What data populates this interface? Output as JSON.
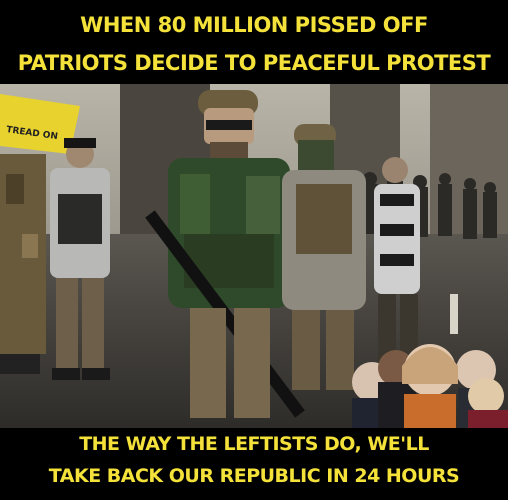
{
  "meme": {
    "top_caption": [
      "WHEN 80 MILLION PISSED OFF",
      "PATRIOTS DECIDE TO PEACEFUL PROTEST"
    ],
    "bottom_caption": [
      "THE WAY THE LEFTISTS DO, WE'LL",
      "TAKE BACK OUR REPUBLIC IN 24 HOURS"
    ],
    "flag_text": "TREAD ON",
    "colors": {
      "caption": "#f4e23a",
      "background": "#000000",
      "flag": "#e7d22e"
    }
  }
}
